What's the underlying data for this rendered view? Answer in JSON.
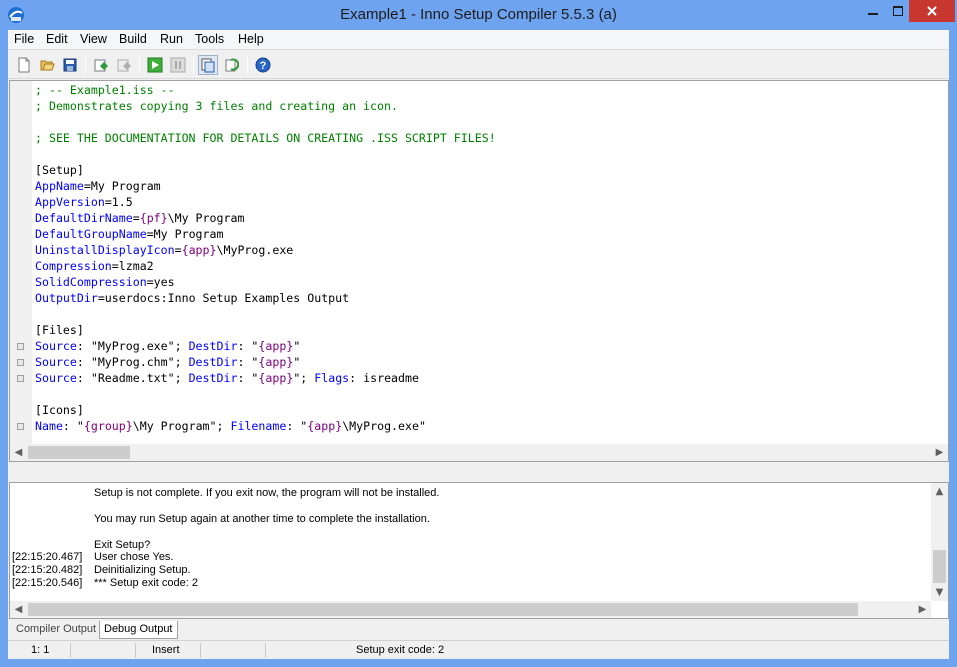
{
  "window": {
    "title": "Example1 - Inno Setup Compiler 5.5.3 (a)"
  },
  "menu": [
    "File",
    "Edit",
    "View",
    "Build",
    "Run",
    "Tools",
    "Help"
  ],
  "toolbar": {
    "icons": [
      "new-file-icon",
      "open-file-icon",
      "save-icon",
      "compile-icon",
      "stop-compile-icon",
      "run-icon",
      "pause-icon",
      "target-setup-icon",
      "target-uninstall-icon",
      "help-icon"
    ]
  },
  "editor": {
    "lines": [
      [
        {
          "t": "; -- Example1.iss --",
          "c": "comment"
        }
      ],
      [
        {
          "t": "; Demonstrates copying 3 files and creating an icon.",
          "c": "comment"
        }
      ],
      [],
      [
        {
          "t": "; SEE THE DOCUMENTATION FOR DETAILS ON CREATING .ISS SCRIPT FILES!",
          "c": "comment"
        }
      ],
      [],
      [
        {
          "t": "[Setup]",
          "c": "section"
        }
      ],
      [
        {
          "t": "AppName",
          "c": "key"
        },
        {
          "t": "=My Program",
          "c": "plain"
        }
      ],
      [
        {
          "t": "AppVersion",
          "c": "key"
        },
        {
          "t": "=1.5",
          "c": "plain"
        }
      ],
      [
        {
          "t": "DefaultDirName",
          "c": "key"
        },
        {
          "t": "=",
          "c": "plain"
        },
        {
          "t": "{pf}",
          "c": "const"
        },
        {
          "t": "\\My Program",
          "c": "plain"
        }
      ],
      [
        {
          "t": "DefaultGroupName",
          "c": "key"
        },
        {
          "t": "=My Program",
          "c": "plain"
        }
      ],
      [
        {
          "t": "UninstallDisplayIcon",
          "c": "key"
        },
        {
          "t": "=",
          "c": "plain"
        },
        {
          "t": "{app}",
          "c": "const"
        },
        {
          "t": "\\MyProg.exe",
          "c": "plain"
        }
      ],
      [
        {
          "t": "Compression",
          "c": "key"
        },
        {
          "t": "=lzma2",
          "c": "plain"
        }
      ],
      [
        {
          "t": "SolidCompression",
          "c": "key"
        },
        {
          "t": "=yes",
          "c": "plain"
        }
      ],
      [
        {
          "t": "OutputDir",
          "c": "key"
        },
        {
          "t": "=userdocs:Inno Setup Examples Output",
          "c": "plain"
        }
      ],
      [],
      [
        {
          "t": "[Files]",
          "c": "section"
        }
      ],
      [
        {
          "t": "Source",
          "c": "key"
        },
        {
          "t": ": \"MyProg.exe\"; ",
          "c": "plain"
        },
        {
          "t": "DestDir",
          "c": "key"
        },
        {
          "t": ": \"",
          "c": "plain"
        },
        {
          "t": "{app}",
          "c": "const"
        },
        {
          "t": "\"",
          "c": "plain"
        }
      ],
      [
        {
          "t": "Source",
          "c": "key"
        },
        {
          "t": ": \"MyProg.chm\"; ",
          "c": "plain"
        },
        {
          "t": "DestDir",
          "c": "key"
        },
        {
          "t": ": \"",
          "c": "plain"
        },
        {
          "t": "{app}",
          "c": "const"
        },
        {
          "t": "\"",
          "c": "plain"
        }
      ],
      [
        {
          "t": "Source",
          "c": "key"
        },
        {
          "t": ": \"Readme.txt\"; ",
          "c": "plain"
        },
        {
          "t": "DestDir",
          "c": "key"
        },
        {
          "t": ": \"",
          "c": "plain"
        },
        {
          "t": "{app}",
          "c": "const"
        },
        {
          "t": "\"; ",
          "c": "plain"
        },
        {
          "t": "Flags",
          "c": "key"
        },
        {
          "t": ": isreadme",
          "c": "plain"
        }
      ],
      [],
      [
        {
          "t": "[Icons]",
          "c": "section"
        }
      ],
      [
        {
          "t": "Name",
          "c": "key"
        },
        {
          "t": ": \"",
          "c": "plain"
        },
        {
          "t": "{group}",
          "c": "const"
        },
        {
          "t": "\\My Program\"; ",
          "c": "plain"
        },
        {
          "t": "Filename",
          "c": "key"
        },
        {
          "t": ": \"",
          "c": "plain"
        },
        {
          "t": "{app}",
          "c": "const"
        },
        {
          "t": "\\MyProg.exe\"",
          "c": "plain"
        }
      ]
    ],
    "fold_markers_at_lines": [
      16,
      17,
      18,
      21
    ]
  },
  "output": {
    "lines": [
      {
        "ts": "",
        "msg": "Setup is not complete. If you exit now, the program will not be installed."
      },
      {
        "ts": "",
        "msg": ""
      },
      {
        "ts": "",
        "msg": "You may run Setup again at another time to complete the installation."
      },
      {
        "ts": "",
        "msg": ""
      },
      {
        "ts": "",
        "msg": "Exit Setup?"
      },
      {
        "ts": "[22:15:20.467]",
        "msg": "User chose Yes."
      },
      {
        "ts": "[22:15:20.482]",
        "msg": "Deinitializing Setup."
      },
      {
        "ts": "[22:15:20.546]",
        "msg": "*** Setup exit code: 2"
      }
    ]
  },
  "tabs": {
    "compiler_output": "Compiler Output",
    "debug_output": "Debug Output",
    "active": "debug_output"
  },
  "statusbar": {
    "position": "1:   1",
    "mode": "Insert",
    "message": "Setup exit code: 2"
  },
  "colors": {
    "comment": "#008000",
    "key": "#0000ff",
    "const": "#800080",
    "close_button": "#c7372f",
    "frame": "#6ea3f0"
  }
}
